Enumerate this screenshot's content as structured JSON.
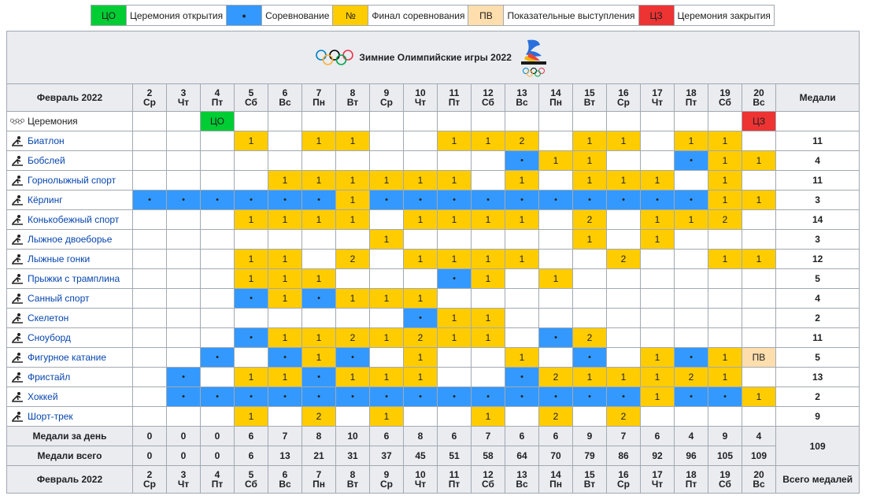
{
  "legend": [
    {
      "code": "ЦО",
      "label": "Церемония открытия",
      "cls": "co"
    },
    {
      "code": "●",
      "label": "Соревнование",
      "cls": "comp"
    },
    {
      "code": "№",
      "label": "Финал соревнования",
      "cls": "fin"
    },
    {
      "code": "ПВ",
      "label": "Показательные выступления",
      "cls": "pv"
    },
    {
      "code": "ЦЗ",
      "label": "Церемония закрытия",
      "cls": "cz"
    }
  ],
  "title": "Зимние Олимпийские игры 2022",
  "month_label": "Февраль 2022",
  "medals_header": "Медали",
  "total_medals_header": "Всего медалей",
  "days": [
    {
      "d": "2",
      "w": "Ср"
    },
    {
      "d": "3",
      "w": "Чт"
    },
    {
      "d": "4",
      "w": "Пт"
    },
    {
      "d": "5",
      "w": "Сб"
    },
    {
      "d": "6",
      "w": "Вс"
    },
    {
      "d": "7",
      "w": "Пн"
    },
    {
      "d": "8",
      "w": "Вт"
    },
    {
      "d": "9",
      "w": "Ср"
    },
    {
      "d": "10",
      "w": "Чт"
    },
    {
      "d": "11",
      "w": "Пт"
    },
    {
      "d": "12",
      "w": "Сб"
    },
    {
      "d": "13",
      "w": "Вс"
    },
    {
      "d": "14",
      "w": "Пн"
    },
    {
      "d": "15",
      "w": "Вт"
    },
    {
      "d": "16",
      "w": "Ср"
    },
    {
      "d": "17",
      "w": "Чт"
    },
    {
      "d": "18",
      "w": "Пт"
    },
    {
      "d": "19",
      "w": "Сб"
    },
    {
      "d": "20",
      "w": "Вс"
    }
  ],
  "ceremony": {
    "label": "Церемония",
    "icon": "olympic-rings-icon",
    "open_day_index": 2,
    "open_text": "ЦО",
    "close_day_index": 18,
    "close_text": "ЦЗ"
  },
  "sports": [
    {
      "name": "Биатлон",
      "icon": "biathlon-icon",
      "total": "11",
      "cells": [
        "",
        "",
        "",
        "1",
        "",
        "1",
        "1",
        "",
        "",
        "1",
        "1",
        "2",
        "",
        "1",
        "1",
        "",
        "1",
        "1",
        ""
      ]
    },
    {
      "name": "Бобслей",
      "icon": "bobsleigh-icon",
      "total": "4",
      "cells": [
        "",
        "",
        "",
        "",
        "",
        "",
        "",
        "",
        "",
        "",
        "",
        "•",
        "1",
        "1",
        "",
        "",
        "•",
        "1",
        "1"
      ]
    },
    {
      "name": "Горнолыжный спорт",
      "icon": "alpine-skiing-icon",
      "total": "11",
      "cells": [
        "",
        "",
        "",
        "",
        "1",
        "1",
        "1",
        "1",
        "1",
        "1",
        "",
        "1",
        "",
        "1",
        "1",
        "1",
        "",
        "1",
        ""
      ]
    },
    {
      "name": "Кёрлинг",
      "icon": "curling-icon",
      "total": "3",
      "cells": [
        "•",
        "•",
        "•",
        "•",
        "•",
        "•",
        "1",
        "•",
        "•",
        "•",
        "•",
        "•",
        "•",
        "•",
        "•",
        "•",
        "•",
        "1",
        "1"
      ]
    },
    {
      "name": "Конькобежный спорт",
      "icon": "speed-skating-icon",
      "total": "14",
      "cells": [
        "",
        "",
        "",
        "1",
        "1",
        "1",
        "1",
        "",
        "1",
        "1",
        "1",
        "1",
        "",
        "2",
        "",
        "1",
        "1",
        "2",
        ""
      ]
    },
    {
      "name": "Лыжное двоеборье",
      "icon": "nordic-combined-icon",
      "total": "3",
      "cells": [
        "",
        "",
        "",
        "",
        "",
        "",
        "",
        "1",
        "",
        "",
        "",
        "",
        "",
        "1",
        "",
        "1",
        "",
        "",
        ""
      ]
    },
    {
      "name": "Лыжные гонки",
      "icon": "cross-country-icon",
      "total": "12",
      "cells": [
        "",
        "",
        "",
        "1",
        "1",
        "",
        "2",
        "",
        "1",
        "1",
        "1",
        "1",
        "",
        "",
        "2",
        "",
        "",
        "1",
        "1"
      ]
    },
    {
      "name": "Прыжки с трамплина",
      "icon": "ski-jumping-icon",
      "total": "5",
      "cells": [
        "",
        "",
        "",
        "1",
        "1",
        "1",
        "",
        "",
        "",
        "•",
        "1",
        "",
        "1",
        "",
        "",
        "",
        "",
        "",
        ""
      ]
    },
    {
      "name": "Санный спорт",
      "icon": "luge-icon",
      "total": "4",
      "cells": [
        "",
        "",
        "",
        "•",
        "1",
        "•",
        "1",
        "1",
        "1",
        "",
        "",
        "",
        "",
        "",
        "",
        "",
        "",
        "",
        ""
      ]
    },
    {
      "name": "Скелетон",
      "icon": "skeleton-icon",
      "total": "2",
      "cells": [
        "",
        "",
        "",
        "",
        "",
        "",
        "",
        "",
        "•",
        "1",
        "1",
        "",
        "",
        "",
        "",
        "",
        "",
        "",
        ""
      ]
    },
    {
      "name": "Сноуборд",
      "icon": "snowboard-icon",
      "total": "11",
      "cells": [
        "",
        "",
        "",
        "•",
        "1",
        "1",
        "2",
        "1",
        "2",
        "1",
        "1",
        "",
        "•",
        "2",
        "",
        "",
        "",
        "",
        ""
      ]
    },
    {
      "name": "Фигурное катание",
      "icon": "figure-skating-icon",
      "total": "5",
      "cells": [
        "",
        "",
        "•",
        "",
        "•",
        "1",
        "•",
        "",
        "1",
        "",
        "",
        "1",
        "",
        "•",
        "",
        "1",
        "•",
        "1",
        "ПВ"
      ]
    },
    {
      "name": "Фристайл",
      "icon": "freestyle-icon",
      "total": "13",
      "cells": [
        "",
        "•",
        "",
        "1",
        "1",
        "•",
        "1",
        "1",
        "1",
        "",
        "",
        "•",
        "2",
        "1",
        "1",
        "1",
        "2",
        "1",
        ""
      ]
    },
    {
      "name": "Хоккей",
      "icon": "hockey-icon",
      "total": "2",
      "cells": [
        "",
        "•",
        "•",
        "•",
        "•",
        "•",
        "•",
        "•",
        "•",
        "•",
        "•",
        "•",
        "•",
        "•",
        "•",
        "1",
        "•",
        "•",
        "1"
      ]
    },
    {
      "name": "Шорт-трек",
      "icon": "short-track-icon",
      "total": "9",
      "cells": [
        "",
        "",
        "",
        "1",
        "",
        "2",
        "",
        "1",
        "",
        "",
        "1",
        "",
        "2",
        "",
        "2",
        "",
        "",
        "",
        ""
      ]
    }
  ],
  "per_day": {
    "label": "Медали за день",
    "values": [
      "0",
      "0",
      "0",
      "6",
      "7",
      "8",
      "10",
      "6",
      "8",
      "6",
      "7",
      "6",
      "6",
      "9",
      "7",
      "6",
      "4",
      "9",
      "4"
    ]
  },
  "cumulative": {
    "label": "Медали всего",
    "values": [
      "0",
      "0",
      "0",
      "6",
      "13",
      "21",
      "31",
      "37",
      "45",
      "51",
      "58",
      "64",
      "70",
      "79",
      "86",
      "92",
      "96",
      "105",
      "109"
    ]
  },
  "grand_total": "109",
  "colors": {
    "co": "#00cc33",
    "comp": "#3399ff",
    "fin": "#ffcc00",
    "pv": "#ffdead",
    "cz": "#ee3333",
    "header_bg": "#eaecf0",
    "link": "#0645ad"
  }
}
